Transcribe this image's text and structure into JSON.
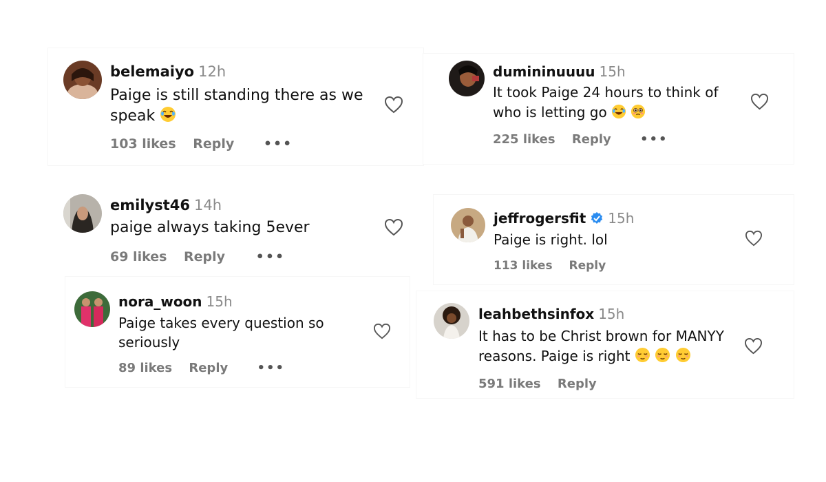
{
  "comments": [
    {
      "username": "belemaiyo",
      "time": "12h",
      "text": "Paige is still standing there as we speak",
      "emojis": [
        "laugh-cry"
      ],
      "likes": "103 likes",
      "reply": "Reply",
      "more": "•••"
    },
    {
      "username": "emilyst46",
      "time": "14h",
      "text": "paige always taking 5ever",
      "emojis": [],
      "likes": "69 likes",
      "reply": "Reply",
      "more": "•••"
    },
    {
      "username": "nora_woon",
      "time": "15h",
      "text": "Paige takes every question so seriously",
      "emojis": [],
      "likes": "89 likes",
      "reply": "Reply",
      "more": "•••"
    },
    {
      "username": "dumininuuuu",
      "time": "15h",
      "text": "It took Paige 24 hours to think of who is letting go",
      "emojis": [
        "laugh-cry",
        "pleading"
      ],
      "likes": "225 likes",
      "reply": "Reply",
      "more": "•••"
    },
    {
      "username": "jeffrogersfit",
      "time": "15h",
      "text": "Paige is right. lol",
      "emojis": [],
      "likes": "113 likes",
      "reply": "Reply",
      "verified": true
    },
    {
      "username": "leahbethsinfox",
      "time": "15h",
      "text": "It has to be Christ brown for MANYY reasons. Paige is right",
      "emojis": [
        "relieved",
        "relieved",
        "relieved"
      ],
      "likes": "591 likes",
      "reply": "Reply"
    }
  ],
  "icons": {
    "heart": "heart-outline-icon",
    "verified": "verified-badge-icon",
    "more": "more-options-icon"
  },
  "colors": {
    "verified": "#2a8cf0",
    "muted": "#7a7a7a",
    "text": "#111111"
  }
}
